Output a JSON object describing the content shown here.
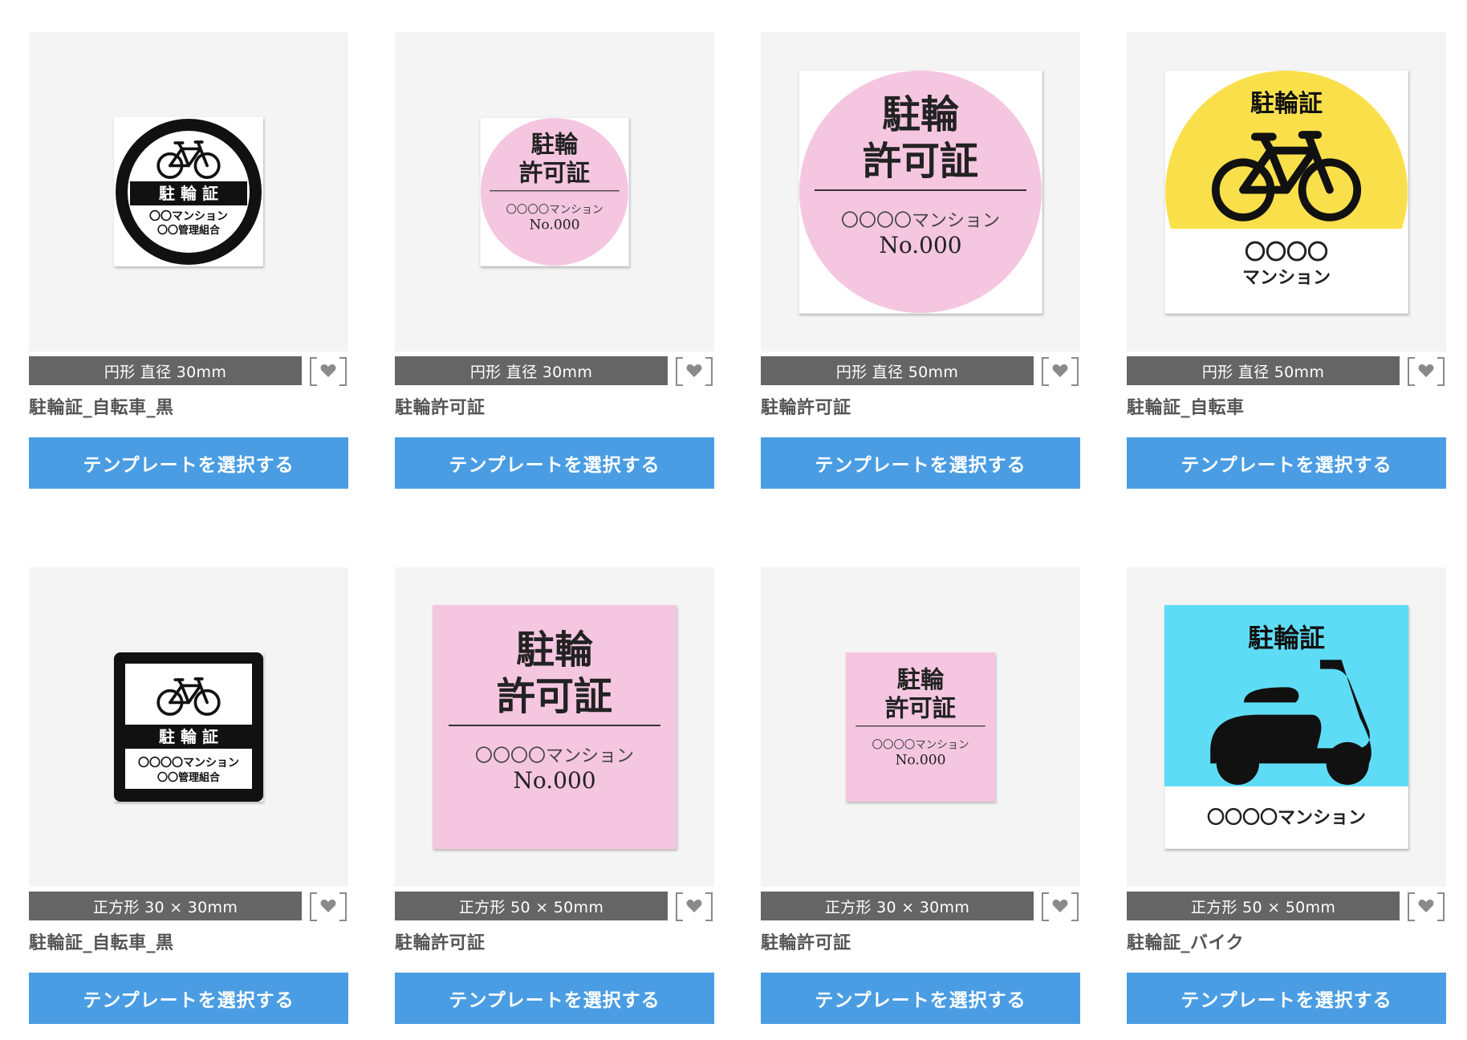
{
  "heart_color": "#8a8a8a",
  "templates": [
    {
      "size_label": "円形 直径 30mm",
      "name": "駐輪証_自転車_黒",
      "button_label": "テンプレートを選択する",
      "design": {
        "kind": "black-circle-bike",
        "shape": "circle",
        "title": "駐 輪 証",
        "line1": "〇〇マンション",
        "line2": "〇〇管理組合",
        "icon": "bicycle-icon"
      }
    },
    {
      "size_label": "円形 直径 30mm",
      "name": "駐輪許可証",
      "button_label": "テンプレートを選択する",
      "design": {
        "kind": "pink-permit",
        "shape": "circle",
        "title1": "駐輪",
        "title2": "許可証",
        "line1": "〇〇〇〇マンション",
        "line2": "No.000",
        "bg_color": "#f5c6e0"
      }
    },
    {
      "size_label": "円形 直径 50mm",
      "name": "駐輪許可証",
      "button_label": "テンプレートを選択する",
      "design": {
        "kind": "pink-permit",
        "shape": "circle",
        "title1": "駐輪",
        "title2": "許可証",
        "line1": "〇〇〇〇マンション",
        "line2": "No.000",
        "bg_color": "#f5c6e0"
      }
    },
    {
      "size_label": "円形 直径 50mm",
      "name": "駐輪証_自転車",
      "button_label": "テンプレートを選択する",
      "design": {
        "kind": "yellow-bike",
        "shape": "circle",
        "title": "駐輪証",
        "line1": "〇〇〇〇",
        "line2": "マンション",
        "bg_color": "#f9e04b",
        "icon": "bicycle-icon"
      }
    },
    {
      "size_label": "正方形 30 × 30mm",
      "name": "駐輪証_自転車_黒",
      "button_label": "テンプレートを選択する",
      "design": {
        "kind": "black-square-bike",
        "shape": "square",
        "title": "駐 輪 証",
        "line1": "〇〇〇〇マンション",
        "line2": "〇〇管理組合",
        "icon": "bicycle-icon"
      }
    },
    {
      "size_label": "正方形 50 × 50mm",
      "name": "駐輪許可証",
      "button_label": "テンプレートを選択する",
      "design": {
        "kind": "pink-permit",
        "shape": "square",
        "title1": "駐輪",
        "title2": "許可証",
        "line1": "〇〇〇〇マンション",
        "line2": "No.000",
        "bg_color": "#f5c6e0"
      }
    },
    {
      "size_label": "正方形 30 × 30mm",
      "name": "駐輪許可証",
      "button_label": "テンプレートを選択する",
      "design": {
        "kind": "pink-permit",
        "shape": "square",
        "title1": "駐輪",
        "title2": "許可証",
        "line1": "〇〇〇〇マンション",
        "line2": "No.000",
        "bg_color": "#f5c6e0"
      }
    },
    {
      "size_label": "正方形 50 × 50mm",
      "name": "駐輪証_バイク",
      "button_label": "テンプレートを選択する",
      "design": {
        "kind": "cyan-scooter",
        "shape": "square",
        "title": "駐輪証",
        "line1": "〇〇〇〇マンション",
        "bg_color": "#5fdcf5",
        "icon": "scooter-icon"
      }
    }
  ]
}
